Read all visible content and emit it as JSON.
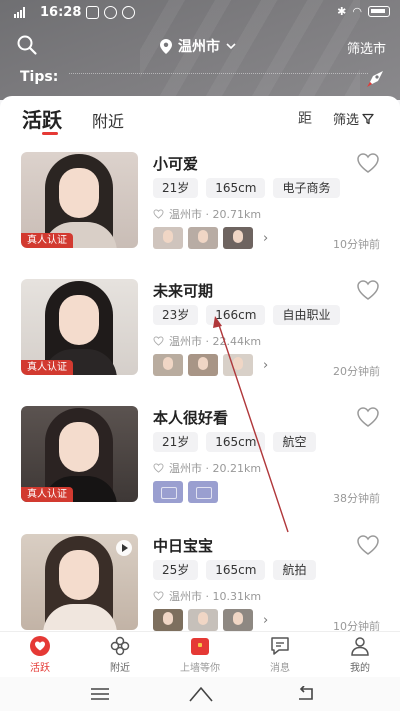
{
  "status_bar": {
    "time": "16:28"
  },
  "header": {
    "location": "温州市",
    "filter_link": "筛选市",
    "tips_label": "Tips:",
    "tips_text": "……………………………………………………………………………………………………………………………………"
  },
  "tabs": {
    "active": "活跃",
    "nearby": "附近",
    "sort_distance": "距",
    "sort_filter": "筛选"
  },
  "verify_badge": "真人认证",
  "profiles": [
    {
      "name": "小可爱",
      "tags": [
        "21岁",
        "165cm",
        "电子商务"
      ],
      "location": "温州市 · 20.71km",
      "active_time": "10分钟前",
      "thumbs": 3
    },
    {
      "name": "未来可期",
      "tags": [
        "23岁",
        "166cm",
        "自由职业"
      ],
      "location": "温州市 · 22.44km",
      "active_time": "20分钟前",
      "thumbs": 3
    },
    {
      "name": "本人很好看",
      "tags": [
        "21岁",
        "165cm",
        "航空"
      ],
      "location": "温州市 · 20.21km",
      "active_time": "38分钟前",
      "thumbs": 0
    },
    {
      "name": "中日宝宝",
      "tags": [
        "25岁",
        "165cm",
        "航拍"
      ],
      "location": "温州市 · 10.31km",
      "active_time": "10分钟前",
      "thumbs": 3
    }
  ],
  "bottom_nav": {
    "active": "活跃",
    "nearby": "附近",
    "wall": "上墙等你",
    "messages": "消息",
    "me": "我的"
  },
  "colors": {
    "accent": "#e53935",
    "header_bg": "#76767a",
    "tag_bg": "#f2f2f4"
  }
}
